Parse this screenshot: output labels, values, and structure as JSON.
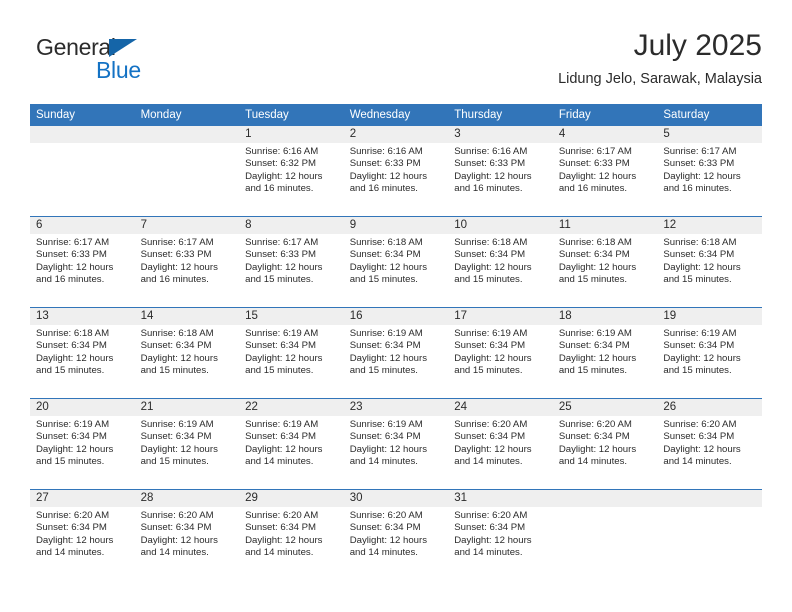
{
  "brand": {
    "name_top": "General",
    "name_bottom": "Blue",
    "triangle_color": "#1565a8",
    "blue_text_color": "#1472c4"
  },
  "header": {
    "title": "July 2025",
    "subtitle": "Lidung Jelo, Sarawak, Malaysia"
  },
  "theme": {
    "header_blue": "#3275b9",
    "day_band_gray": "#efefef",
    "text_color": "#2b2b2b"
  },
  "weekdays": [
    "Sunday",
    "Monday",
    "Tuesday",
    "Wednesday",
    "Thursday",
    "Friday",
    "Saturday"
  ],
  "weeks": [
    [
      {
        "day": "",
        "sunrise": "",
        "sunset": "",
        "daylight": ""
      },
      {
        "day": "",
        "sunrise": "",
        "sunset": "",
        "daylight": ""
      },
      {
        "day": "1",
        "sunrise": "Sunrise: 6:16 AM",
        "sunset": "Sunset: 6:32 PM",
        "daylight": "Daylight: 12 hours and 16 minutes."
      },
      {
        "day": "2",
        "sunrise": "Sunrise: 6:16 AM",
        "sunset": "Sunset: 6:33 PM",
        "daylight": "Daylight: 12 hours and 16 minutes."
      },
      {
        "day": "3",
        "sunrise": "Sunrise: 6:16 AM",
        "sunset": "Sunset: 6:33 PM",
        "daylight": "Daylight: 12 hours and 16 minutes."
      },
      {
        "day": "4",
        "sunrise": "Sunrise: 6:17 AM",
        "sunset": "Sunset: 6:33 PM",
        "daylight": "Daylight: 12 hours and 16 minutes."
      },
      {
        "day": "5",
        "sunrise": "Sunrise: 6:17 AM",
        "sunset": "Sunset: 6:33 PM",
        "daylight": "Daylight: 12 hours and 16 minutes."
      }
    ],
    [
      {
        "day": "6",
        "sunrise": "Sunrise: 6:17 AM",
        "sunset": "Sunset: 6:33 PM",
        "daylight": "Daylight: 12 hours and 16 minutes."
      },
      {
        "day": "7",
        "sunrise": "Sunrise: 6:17 AM",
        "sunset": "Sunset: 6:33 PM",
        "daylight": "Daylight: 12 hours and 16 minutes."
      },
      {
        "day": "8",
        "sunrise": "Sunrise: 6:17 AM",
        "sunset": "Sunset: 6:33 PM",
        "daylight": "Daylight: 12 hours and 15 minutes."
      },
      {
        "day": "9",
        "sunrise": "Sunrise: 6:18 AM",
        "sunset": "Sunset: 6:34 PM",
        "daylight": "Daylight: 12 hours and 15 minutes."
      },
      {
        "day": "10",
        "sunrise": "Sunrise: 6:18 AM",
        "sunset": "Sunset: 6:34 PM",
        "daylight": "Daylight: 12 hours and 15 minutes."
      },
      {
        "day": "11",
        "sunrise": "Sunrise: 6:18 AM",
        "sunset": "Sunset: 6:34 PM",
        "daylight": "Daylight: 12 hours and 15 minutes."
      },
      {
        "day": "12",
        "sunrise": "Sunrise: 6:18 AM",
        "sunset": "Sunset: 6:34 PM",
        "daylight": "Daylight: 12 hours and 15 minutes."
      }
    ],
    [
      {
        "day": "13",
        "sunrise": "Sunrise: 6:18 AM",
        "sunset": "Sunset: 6:34 PM",
        "daylight": "Daylight: 12 hours and 15 minutes."
      },
      {
        "day": "14",
        "sunrise": "Sunrise: 6:18 AM",
        "sunset": "Sunset: 6:34 PM",
        "daylight": "Daylight: 12 hours and 15 minutes."
      },
      {
        "day": "15",
        "sunrise": "Sunrise: 6:19 AM",
        "sunset": "Sunset: 6:34 PM",
        "daylight": "Daylight: 12 hours and 15 minutes."
      },
      {
        "day": "16",
        "sunrise": "Sunrise: 6:19 AM",
        "sunset": "Sunset: 6:34 PM",
        "daylight": "Daylight: 12 hours and 15 minutes."
      },
      {
        "day": "17",
        "sunrise": "Sunrise: 6:19 AM",
        "sunset": "Sunset: 6:34 PM",
        "daylight": "Daylight: 12 hours and 15 minutes."
      },
      {
        "day": "18",
        "sunrise": "Sunrise: 6:19 AM",
        "sunset": "Sunset: 6:34 PM",
        "daylight": "Daylight: 12 hours and 15 minutes."
      },
      {
        "day": "19",
        "sunrise": "Sunrise: 6:19 AM",
        "sunset": "Sunset: 6:34 PM",
        "daylight": "Daylight: 12 hours and 15 minutes."
      }
    ],
    [
      {
        "day": "20",
        "sunrise": "Sunrise: 6:19 AM",
        "sunset": "Sunset: 6:34 PM",
        "daylight": "Daylight: 12 hours and 15 minutes."
      },
      {
        "day": "21",
        "sunrise": "Sunrise: 6:19 AM",
        "sunset": "Sunset: 6:34 PM",
        "daylight": "Daylight: 12 hours and 15 minutes."
      },
      {
        "day": "22",
        "sunrise": "Sunrise: 6:19 AM",
        "sunset": "Sunset: 6:34 PM",
        "daylight": "Daylight: 12 hours and 14 minutes."
      },
      {
        "day": "23",
        "sunrise": "Sunrise: 6:19 AM",
        "sunset": "Sunset: 6:34 PM",
        "daylight": "Daylight: 12 hours and 14 minutes."
      },
      {
        "day": "24",
        "sunrise": "Sunrise: 6:20 AM",
        "sunset": "Sunset: 6:34 PM",
        "daylight": "Daylight: 12 hours and 14 minutes."
      },
      {
        "day": "25",
        "sunrise": "Sunrise: 6:20 AM",
        "sunset": "Sunset: 6:34 PM",
        "daylight": "Daylight: 12 hours and 14 minutes."
      },
      {
        "day": "26",
        "sunrise": "Sunrise: 6:20 AM",
        "sunset": "Sunset: 6:34 PM",
        "daylight": "Daylight: 12 hours and 14 minutes."
      }
    ],
    [
      {
        "day": "27",
        "sunrise": "Sunrise: 6:20 AM",
        "sunset": "Sunset: 6:34 PM",
        "daylight": "Daylight: 12 hours and 14 minutes."
      },
      {
        "day": "28",
        "sunrise": "Sunrise: 6:20 AM",
        "sunset": "Sunset: 6:34 PM",
        "daylight": "Daylight: 12 hours and 14 minutes."
      },
      {
        "day": "29",
        "sunrise": "Sunrise: 6:20 AM",
        "sunset": "Sunset: 6:34 PM",
        "daylight": "Daylight: 12 hours and 14 minutes."
      },
      {
        "day": "30",
        "sunrise": "Sunrise: 6:20 AM",
        "sunset": "Sunset: 6:34 PM",
        "daylight": "Daylight: 12 hours and 14 minutes."
      },
      {
        "day": "31",
        "sunrise": "Sunrise: 6:20 AM",
        "sunset": "Sunset: 6:34 PM",
        "daylight": "Daylight: 12 hours and 14 minutes."
      },
      {
        "day": "",
        "sunrise": "",
        "sunset": "",
        "daylight": ""
      },
      {
        "day": "",
        "sunrise": "",
        "sunset": "",
        "daylight": ""
      }
    ]
  ]
}
